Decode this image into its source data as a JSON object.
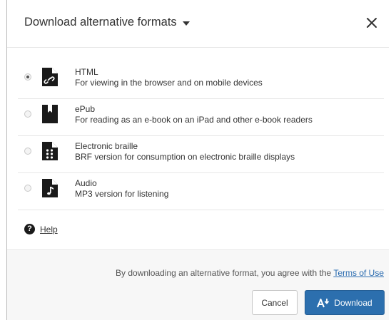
{
  "dialog": {
    "title": "Download alternative formats"
  },
  "options": [
    {
      "title": "HTML",
      "description": "For viewing in the browser and on mobile devices",
      "icon": "html-file-icon",
      "selected": true
    },
    {
      "title": "ePub",
      "description": "For reading as an e-book on an iPad and other e-book readers",
      "icon": "epub-file-icon",
      "selected": false
    },
    {
      "title": "Electronic braille",
      "description": "BRF version for consumption on electronic braille displays",
      "icon": "braille-file-icon",
      "selected": false
    },
    {
      "title": "Audio",
      "description": "MP3 version for listening",
      "icon": "audio-file-icon",
      "selected": false
    }
  ],
  "help": {
    "label": "Help",
    "icon": "question-circle-icon"
  },
  "footer": {
    "agree_prefix": "By downloading an alternative format, you agree with the ",
    "terms_link": "Terms of Use",
    "cancel_label": "Cancel",
    "download_label": "Download"
  },
  "colors": {
    "primary": "#2c6fae",
    "link": "#2b6cb0",
    "footer_bg": "#f7f7f7"
  }
}
